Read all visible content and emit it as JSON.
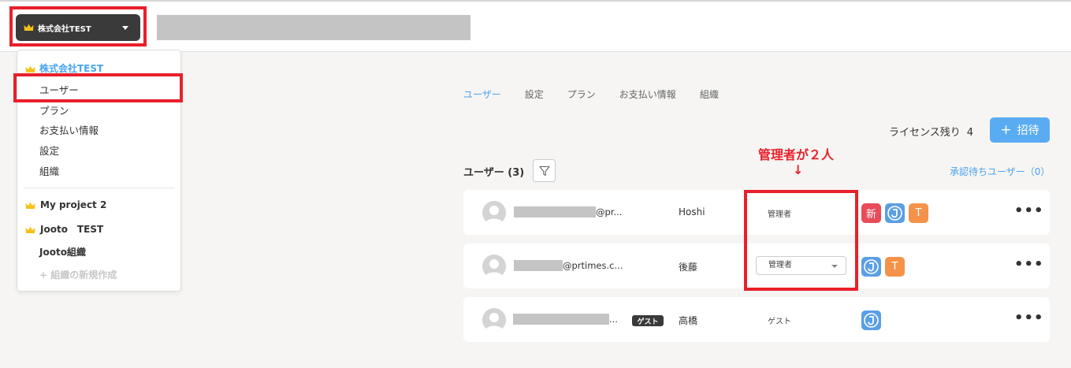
{
  "header": {
    "org_name": "株式会社TEST"
  },
  "dropdown": {
    "org_name": "株式会社TEST",
    "items": [
      {
        "label": "ユーザー"
      },
      {
        "label": "プラン"
      },
      {
        "label": "お支払い情報"
      },
      {
        "label": "設定"
      },
      {
        "label": "組織"
      }
    ],
    "projects": [
      {
        "label": "My project 2"
      },
      {
        "label": "Jooto　TEST"
      },
      {
        "label": "Jooto組織"
      }
    ],
    "new_org": "+ 組織の新規作成"
  },
  "tabs": [
    {
      "label": "ユーザー",
      "active": true
    },
    {
      "label": "設定"
    },
    {
      "label": "プラン"
    },
    {
      "label": "お支払い情報"
    },
    {
      "label": "組織"
    }
  ],
  "license": {
    "label": "ライセンス残り",
    "count": "4"
  },
  "invite_button": {
    "plus": "+",
    "label": "招待"
  },
  "annotation": {
    "text": "管理者が２人",
    "arrow": "↓"
  },
  "users": {
    "title": "ユーザー (3)",
    "pending_link": "承認待ちユーザー（0）",
    "rows": [
      {
        "email": "@pr...",
        "name": "Hoshi",
        "role": "管理者",
        "badges": [
          "新",
          "J",
          "T"
        ]
      },
      {
        "email": "@prtimes.c...",
        "name": "後藤",
        "role": "管理者",
        "badges": [
          "J",
          "T"
        ]
      },
      {
        "email": "...",
        "guest_badge": "ゲスト",
        "name": "高橋",
        "role": "ゲスト",
        "badges": [
          "J"
        ]
      }
    ]
  },
  "colors": {
    "accent": "#49a4f0",
    "highlight": "#e8202a",
    "new_badge": "#e84c5a",
    "t_badge": "#f5924a",
    "j_badge": "#5a9ee6"
  }
}
